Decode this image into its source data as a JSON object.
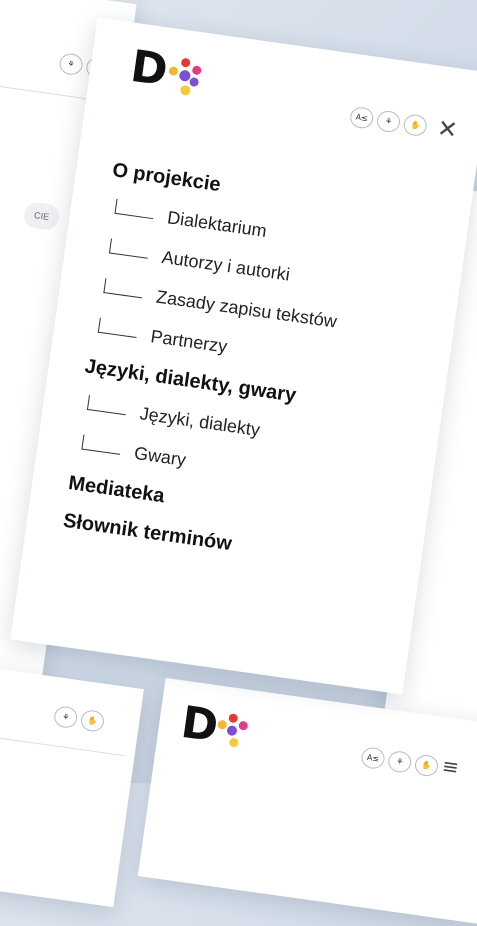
{
  "brand": {
    "letter": "D",
    "dot_colors": [
      "#f5b730",
      "#e53a2f",
      "#7c4fd6",
      "#f5b730",
      "#e53a8c",
      "#7c4fd6",
      "#f5c93a"
    ]
  },
  "accessibility": {
    "font_size_label": "A≤",
    "motion_label": "⚘",
    "sign_language_label": "✋"
  },
  "close_label": "✕",
  "menu": [
    {
      "type": "section",
      "label": "O projekcie"
    },
    {
      "type": "item",
      "label": "Dialektarium"
    },
    {
      "type": "item",
      "label": "Autorzy i autorki"
    },
    {
      "type": "item",
      "label": "Zasady zapisu tekstów"
    },
    {
      "type": "item",
      "label": "Partnerzy"
    },
    {
      "type": "section",
      "label": "Języki, dialekty, gwary"
    },
    {
      "type": "item",
      "label": "Języki, dialekty"
    },
    {
      "type": "item",
      "label": "Gwary"
    },
    {
      "type": "section",
      "label": "Mediateka"
    },
    {
      "type": "section",
      "label": "Słownik terminów"
    }
  ],
  "background_cards": {
    "left_pill": "CIE",
    "hamburger": "≡"
  },
  "colors": {
    "accent_blue": "#5f73ff",
    "background": "#cfd9e6"
  }
}
